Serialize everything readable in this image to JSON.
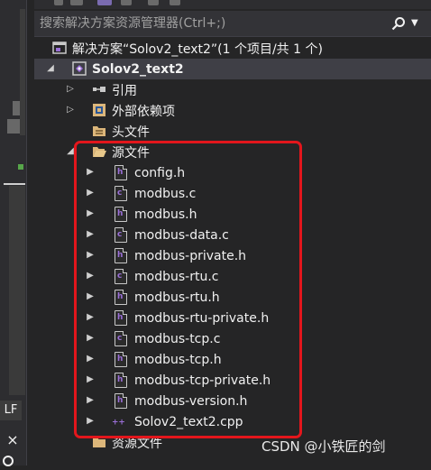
{
  "search": {
    "placeholder": "搜索解决方案资源管理器(Ctrl+;)"
  },
  "left_strip": {
    "lf": "LF",
    "close": "×",
    "q": "Q"
  },
  "tree": {
    "solution": "解决方案“Solov2_text2”(1 个项目/共 1 个)",
    "project": "Solov2_text2",
    "refs": "引用",
    "external": "外部依赖项",
    "headers": "头文件",
    "sources": "源文件",
    "files": [
      "config.h",
      "modbus.c",
      "modbus.h",
      "modbus-data.c",
      "modbus-private.h",
      "modbus-rtu.c",
      "modbus-rtu.h",
      "modbus-rtu-private.h",
      "modbus-tcp.c",
      "modbus-tcp.h",
      "modbus-tcp-private.h",
      "modbus-version.h",
      "Solov2_text2.cpp"
    ],
    "resources": "资源文件"
  },
  "watermark": "CSDN @小铁匠的剑",
  "colors": {
    "highlight_border": "#e3161c",
    "background": "#252526",
    "selection": "#3f3f46"
  }
}
